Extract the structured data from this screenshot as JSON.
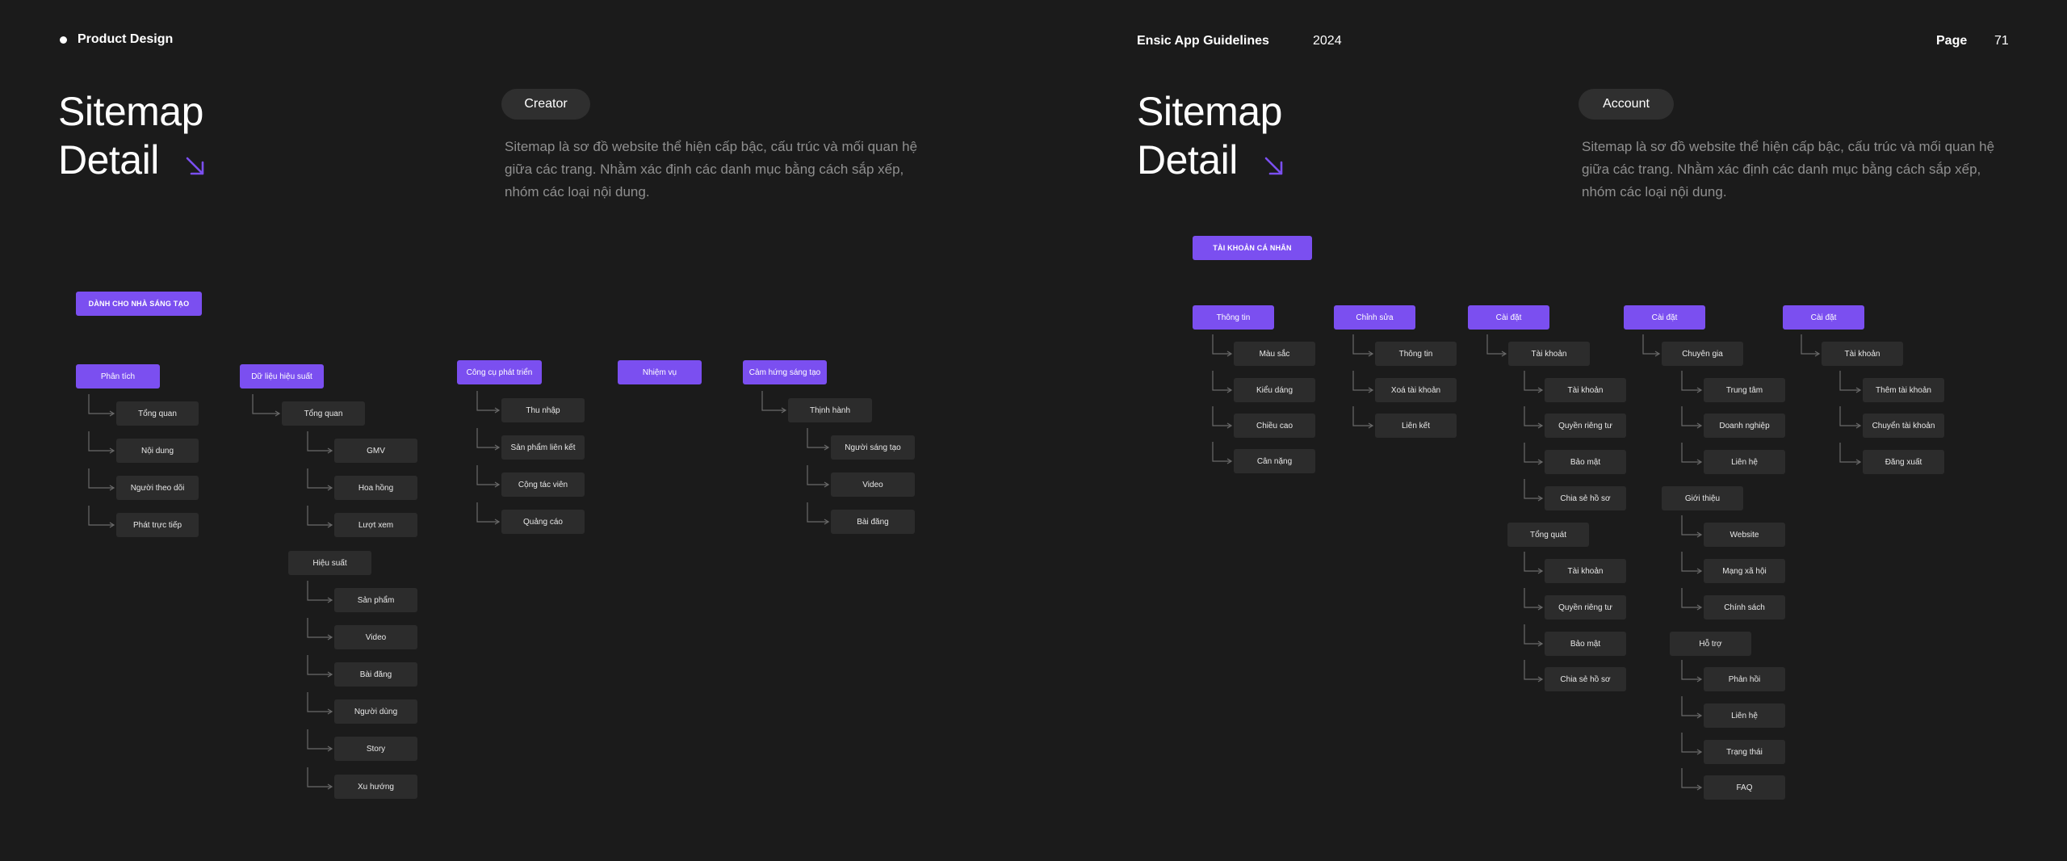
{
  "header": {
    "section": "Product Design",
    "guideline": "Ensic App Guidelines",
    "year": "2024",
    "page_label": "Page",
    "page_number": "71"
  },
  "colors": {
    "accent": "#7b4ff0",
    "node": "#2c2c2c",
    "background": "#1b1b1b"
  },
  "left_panel": {
    "title_line1": "Sitemap",
    "title_line2": "Detail",
    "pill": "Creator",
    "description": "Sitemap là sơ đồ website thể hiện cấp bậc, cấu trúc và mối quan hệ giữa các trang. Nhằm xác định các danh mục bằng cách sắp xếp, nhóm các loại nội dung."
  },
  "right_panel": {
    "title_line1": "Sitemap",
    "title_line2": "Detail",
    "pill": "Account",
    "description": "Sitemap là sơ đồ website thể hiện cấp bậc, cấu trúc và mối quan hệ giữa các trang. Nhằm xác định các danh mục bằng cách sắp xếp, nhóm các loại nội dung."
  },
  "creator_tree": {
    "root": "DÀNH CHO NHÀ SÁNG TẠO",
    "sections": [
      {
        "label": "Phân tích",
        "children": [
          "Tổng quan",
          "Nội dung",
          "Người theo dõi",
          "Phát trực tiếp"
        ]
      },
      {
        "label": "Dữ liệu hiệu suất",
        "groups": [
          {
            "label": "Tổng quan",
            "children": [
              "GMV",
              "Hoa hồng",
              "Lượt xem"
            ]
          },
          {
            "label": "Hiệu suất",
            "children": [
              "Sản phẩm",
              "Video",
              "Bài đăng",
              "Người dùng",
              "Story",
              "Xu hướng"
            ]
          }
        ]
      },
      {
        "label": "Công cụ phát triển",
        "children": [
          "Thu nhập",
          "Sản phẩm liên kết",
          "Cộng tác viên",
          "Quảng cáo"
        ]
      },
      {
        "label": "Nhiệm vụ"
      },
      {
        "label": "Cảm hứng sáng tạo",
        "groups": [
          {
            "label": "Thịnh hành",
            "children": [
              "Người sáng tạo",
              "Video",
              "Bài đăng"
            ]
          }
        ]
      }
    ]
  },
  "account_tree": {
    "root": "TÀI KHOẢN CÁ NHÂN",
    "sections": [
      {
        "label": "Thông tin",
        "children": [
          "Màu sắc",
          "Kiểu dáng",
          "Chiều cao",
          "Cân nặng"
        ]
      },
      {
        "label": "Chỉnh sửa",
        "children": [
          "Thông tin",
          "Xoá tài khoản",
          "Liên kết"
        ]
      },
      {
        "label": "Cài đặt",
        "groups": [
          {
            "label": "Tài khoản",
            "children": [
              "Tài khoản",
              "Quyền riêng tư",
              "Bảo mật",
              "Chia sẻ hồ sơ"
            ]
          },
          {
            "label": "Tổng quát",
            "children": [
              "Tài khoản",
              "Quyền riêng tư",
              "Bảo mật",
              "Chia sẻ hồ sơ"
            ]
          }
        ]
      },
      {
        "label": "Cài đặt",
        "groups": [
          {
            "label": "Chuyên gia",
            "children": [
              "Trung tâm",
              "Doanh nghiệp",
              "Liên hệ"
            ]
          },
          {
            "label": "Giới thiệu",
            "children": [
              "Website",
              "Mạng xã hội",
              "Chính sách"
            ]
          },
          {
            "label": "Hỗ trợ",
            "children": [
              "Phản hồi",
              "Liên hệ",
              "Trạng thái",
              "FAQ"
            ]
          }
        ]
      },
      {
        "label": "Cài đặt",
        "groups": [
          {
            "label": "Tài khoản",
            "children": [
              "Thêm tài khoản",
              "Chuyển tài khoản",
              "Đăng xuất"
            ]
          }
        ]
      }
    ]
  }
}
